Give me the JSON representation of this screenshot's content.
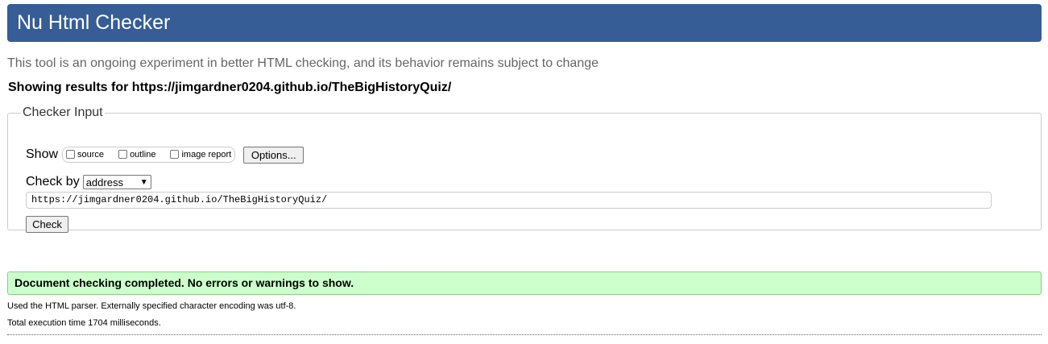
{
  "header": {
    "title": "Nu Html Checker",
    "background": "#365d95"
  },
  "intro_text": "This tool is an ongoing experiment in better HTML checking, and its behavior remains subject to change",
  "showing_results": "Showing results for https://jimgardner0204.github.io/TheBigHistoryQuiz/",
  "checker_input": {
    "legend": "Checker Input",
    "show_label": "Show",
    "show_options": [
      {
        "label": "source",
        "checked": false
      },
      {
        "label": "outline",
        "checked": false
      },
      {
        "label": "image report",
        "checked": false
      }
    ],
    "options_button": "Options...",
    "check_by_label": "Check by",
    "check_by_selected": "address",
    "url_value": "https://jimgardner0204.github.io/TheBigHistoryQuiz/",
    "check_button": "Check"
  },
  "result": {
    "message": "Document checking completed. No errors or warnings to show.",
    "background": "#ccffcc"
  },
  "details": {
    "parser_line": "Used the HTML parser. Externally specified character encoding was utf-8.",
    "time_line": "Total execution time 1704 milliseconds."
  }
}
